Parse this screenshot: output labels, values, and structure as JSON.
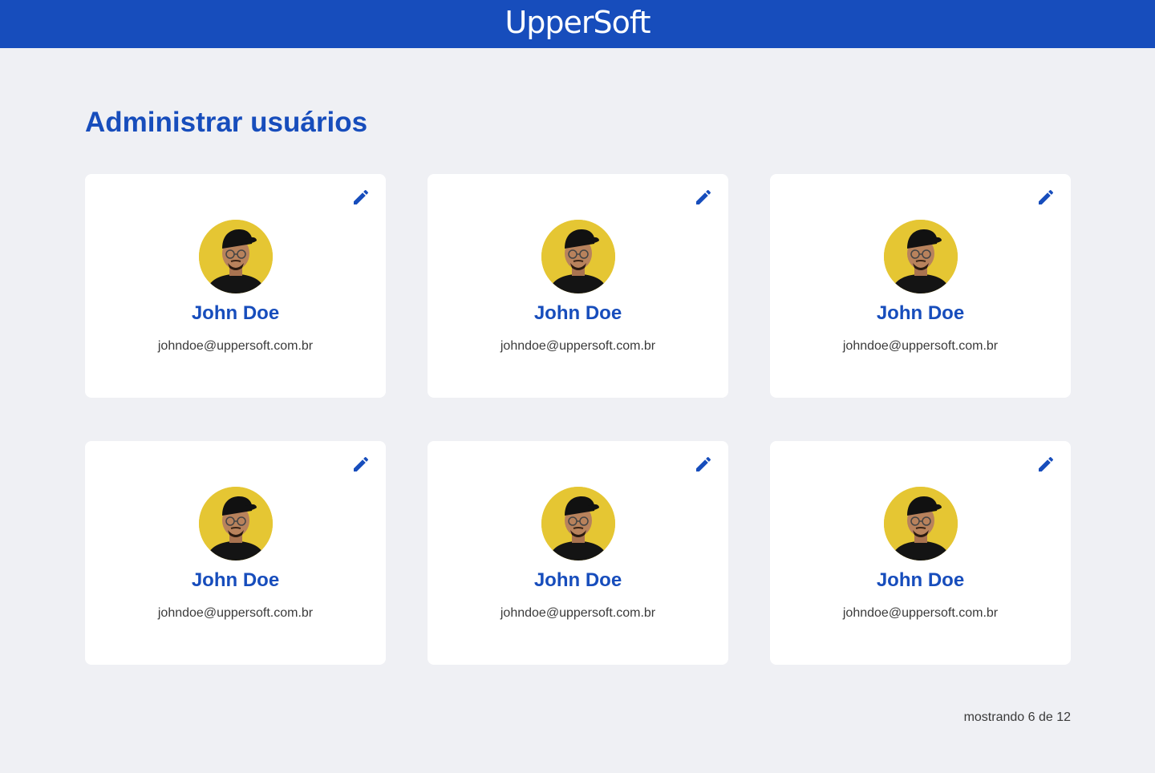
{
  "header": {
    "logo_text": "UpperSoft",
    "background_color": "#174DBC"
  },
  "page": {
    "title": "Administrar usuários",
    "accent_color": "#174DBC"
  },
  "users": [
    {
      "name": "John Doe",
      "email": "johndoe@uppersoft.com.br",
      "avatar_icon": "user-photo",
      "edit_icon": "pencil-icon"
    },
    {
      "name": "John Doe",
      "email": "johndoe@uppersoft.com.br",
      "avatar_icon": "user-photo",
      "edit_icon": "pencil-icon"
    },
    {
      "name": "John Doe",
      "email": "johndoe@uppersoft.com.br",
      "avatar_icon": "user-photo",
      "edit_icon": "pencil-icon"
    },
    {
      "name": "John Doe",
      "email": "johndoe@uppersoft.com.br",
      "avatar_icon": "user-photo",
      "edit_icon": "pencil-icon"
    },
    {
      "name": "John Doe",
      "email": "johndoe@uppersoft.com.br",
      "avatar_icon": "user-photo",
      "edit_icon": "pencil-icon"
    },
    {
      "name": "John Doe",
      "email": "johndoe@uppersoft.com.br",
      "avatar_icon": "user-photo",
      "edit_icon": "pencil-icon"
    }
  ],
  "pagination": {
    "status": "mostrando 6 de 12"
  }
}
